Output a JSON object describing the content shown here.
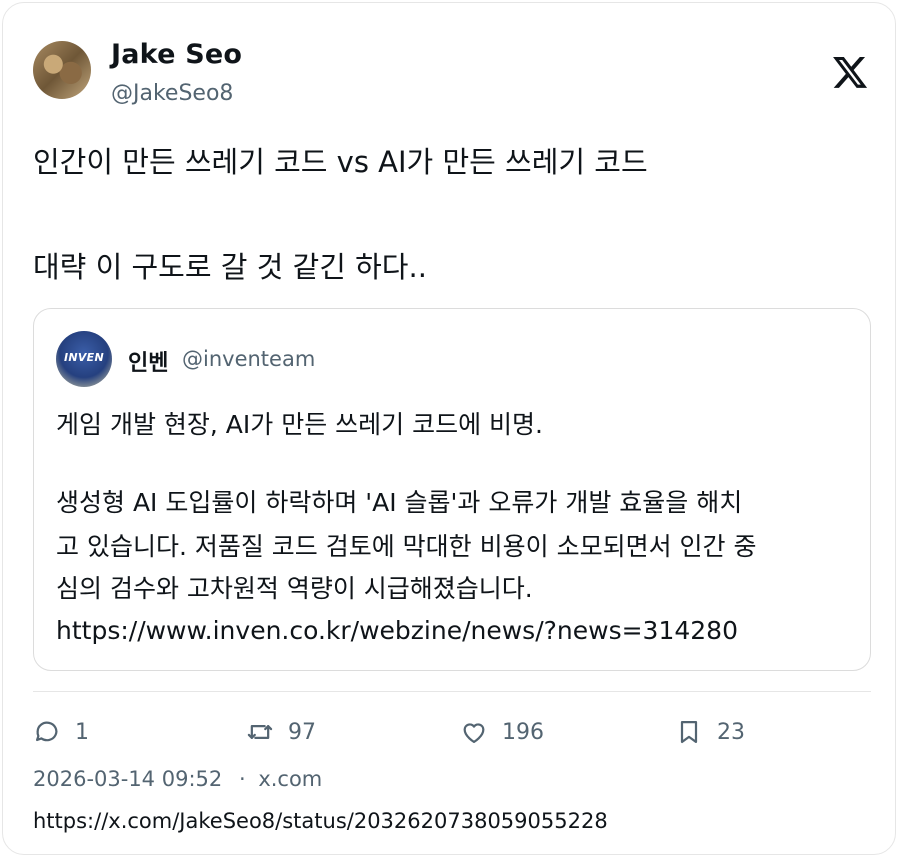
{
  "author": {
    "name": "Jake Seo",
    "handle": "@JakeSeo8"
  },
  "tweet": {
    "line1": "인간이 만든 쓰레기 코드 vs AI가 만든 쓰레기 코드",
    "line2": "대략 이 구도로 갈 것 같긴 하다.."
  },
  "quoted": {
    "name": "인벤",
    "handle": "@inventeam",
    "avatar_text": "INVEN",
    "line1": "게임 개발 현장, AI가 만든 쓰레기 코드에 비명.",
    "line2": "생성형 AI 도입률이 하락하며 'AI 슬롭'과 오류가 개발 효율을 해치",
    "line3": "고 있습니다. 저품질 코드 검토에 막대한 비용이 소모되면서 인간 중",
    "line4": "심의 검수와 고차원적 역량이 시급해졌습니다.",
    "link": "https://www.inven.co.kr/webzine/news/?news=314280"
  },
  "actions": {
    "replies": "1",
    "retweets": "97",
    "likes": "196",
    "bookmarks": "23"
  },
  "meta": {
    "timestamp": "2026-03-14 09:52",
    "separator": "·",
    "source": "x.com",
    "status_url": "https://x.com/JakeSeo8/status/2032620738059055228"
  },
  "icons": [
    "x-logo-icon",
    "reply-icon",
    "retweet-icon",
    "like-icon",
    "bookmark-icon"
  ]
}
